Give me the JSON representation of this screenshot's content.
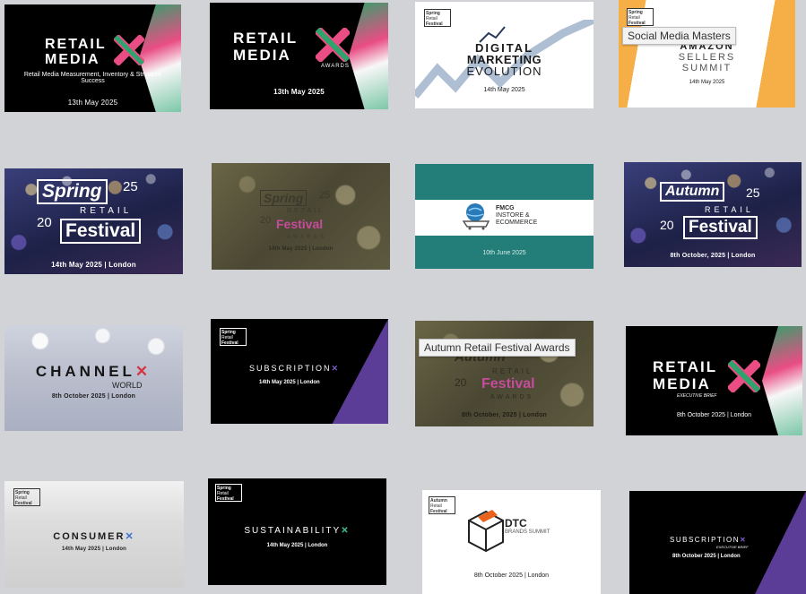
{
  "cards": [
    {
      "title1": "RETAIL",
      "title2": "MEDIA",
      "subtitle": "Retail Media Measurement, Inventory & Structure Success",
      "date": "13th May 2025"
    },
    {
      "title1": "RETAIL",
      "title2": "MEDIA",
      "badge": "AWARDS",
      "date": "13th May 2025"
    },
    {
      "logo": [
        "Spring",
        "Retail",
        "Festival"
      ],
      "title1": "DIGITAL",
      "title2": "MARKETING",
      "title3": "EVOLUTION",
      "date": "14th May 2025"
    },
    {
      "logo": [
        "Spring",
        "Retail",
        "Festival"
      ],
      "title1": "AMAZON",
      "title2": "SELLERS",
      "title3": "SUMMIT",
      "date": "14th May 2025"
    },
    {
      "word1": "Spring",
      "year_top": "25",
      "middle": "RETAIL",
      "year_bottom": "20",
      "word2": "Festival",
      "date": "14th May 2025 | London"
    },
    {
      "word1": "Spring",
      "year_top": "25",
      "middle": "RETAIL",
      "year_bottom": "20",
      "word2": "Festival",
      "word3": "AWARDS",
      "date": "14th May 2025 | London"
    },
    {
      "title1": "FMCG",
      "title2": "INSTORE &",
      "title3": "ECOMMERCE",
      "date": "10th June 2025"
    },
    {
      "word1": "Autumn",
      "year_top": "25",
      "middle": "RETAIL",
      "year_bottom": "20",
      "word2": "Festival",
      "date": "8th October, 2025 | London"
    },
    {
      "title1": "CHANNEL",
      "title2": "WORLD",
      "date": "8th October 2025 | London"
    },
    {
      "logo": [
        "Spring",
        "Retail",
        "Festival"
      ],
      "title1": "SUBSCRIPTION",
      "date": "14th May 2025 | London"
    },
    {
      "word1": "Autumn",
      "middle": "RETAIL",
      "year_bottom": "20",
      "word2": "Festival",
      "word3": "AWARDS",
      "date": "8th October, 2025 | London"
    },
    {
      "title1": "RETAIL",
      "title2": "MEDIA",
      "badge": "EXECUTIVE BRIEF",
      "date": "8th October 2025 | London"
    },
    {
      "logo": [
        "Spring",
        "Retail",
        "Festival"
      ],
      "title1": "CONSUMER",
      "date": "14th May 2025 | London"
    },
    {
      "logo": [
        "Spring",
        "Retail",
        "Festival"
      ],
      "title1": "SUSTAINABILITY",
      "date": "14th May 2025 | London"
    },
    {
      "logo": [
        "Autumn",
        "Retail",
        "Festival"
      ],
      "title1": "DTC",
      "title2": "BRANDS SUMMIT",
      "date": "8th October 2025 | London"
    },
    {
      "title1": "SUBSCRIPTION",
      "badge": "EXECUTIVE BRIEF",
      "date": "8th October 2025 | London"
    }
  ],
  "tooltips": {
    "social": "Social Media Masters",
    "autumn_awards": "Autumn Retail Festival Awards"
  },
  "icons": [
    "x-logo-icon",
    "chart-line-icon",
    "globe-cart-icon",
    "box-icon"
  ],
  "colors": {
    "accent_orange": "#f6ae47",
    "teal": "#237d78",
    "purple": "#5b3c97",
    "red_x": "#d63343",
    "green_x": "#3fbf8c"
  }
}
